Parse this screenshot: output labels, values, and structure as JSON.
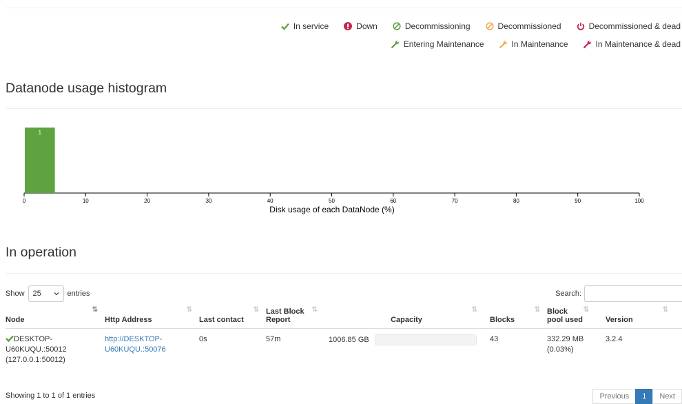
{
  "legend": {
    "row1": [
      {
        "icon": "checkmark-icon",
        "label": "In service",
        "color": "#5fa341"
      },
      {
        "icon": "exclamation-circle-icon",
        "label": "Down",
        "color": "#c7254e"
      },
      {
        "icon": "ban-icon",
        "label": "Decommissioning",
        "color": "#5fa341"
      },
      {
        "icon": "ban-icon",
        "label": "Decommissioned",
        "color": "#f0ad4e"
      },
      {
        "icon": "power-icon",
        "label": "Decommissioned & dead",
        "color": "#c7254e"
      }
    ],
    "row2": [
      {
        "icon": "wrench-icon",
        "label": "Entering Maintenance",
        "color": "#5fa341"
      },
      {
        "icon": "wrench-icon",
        "label": "In Maintenance",
        "color": "#f0ad4e"
      },
      {
        "icon": "wrench-icon",
        "label": "In Maintenance & dead",
        "color": "#c7254e"
      }
    ]
  },
  "histogram_title": "Datanode usage histogram",
  "chart_data": {
    "type": "bar",
    "bins": [
      {
        "from": 0,
        "to": 5,
        "count": 1
      }
    ],
    "bar_label": "1",
    "xlabel": "Disk usage of each DataNode (%)",
    "xticks": [
      "0",
      "10",
      "20",
      "30",
      "40",
      "50",
      "60",
      "70",
      "80",
      "90",
      "100"
    ],
    "xlim": [
      0,
      100
    ],
    "bar_color": "#5fa341"
  },
  "operation_title": "In operation",
  "controls": {
    "show_label": "Show",
    "page_size": "25",
    "entries_label": "entries",
    "search_label": "Search:"
  },
  "table": {
    "headers": {
      "node": "Node",
      "http": "Http Address",
      "last_contact": "Last contact",
      "last_block_1": "Last Block",
      "last_block_2": "Report",
      "capacity": "Capacity",
      "blocks": "Blocks",
      "pool_1": "Block",
      "pool_2": "pool used",
      "version": "Version"
    },
    "row": {
      "node_1": "DESKTOP-",
      "node_2": "U60KUQU.:50012",
      "node_3": "(127.0.0.1:50012)",
      "http_1": "http://DESKTOP-",
      "http_2": "U60KUQU.:50076",
      "last_contact": "0s",
      "last_block": "57m",
      "capacity_text": "1006.85 GB",
      "capacity_used_fraction": 0.0003,
      "blocks": "43",
      "pool_1": "332.29 MB",
      "pool_2": "(0.03%)",
      "version": "3.2.4"
    }
  },
  "footer": {
    "info": "Showing 1 to 1 of 1 entries",
    "previous": "Previous",
    "page": "1",
    "next": "Next"
  }
}
